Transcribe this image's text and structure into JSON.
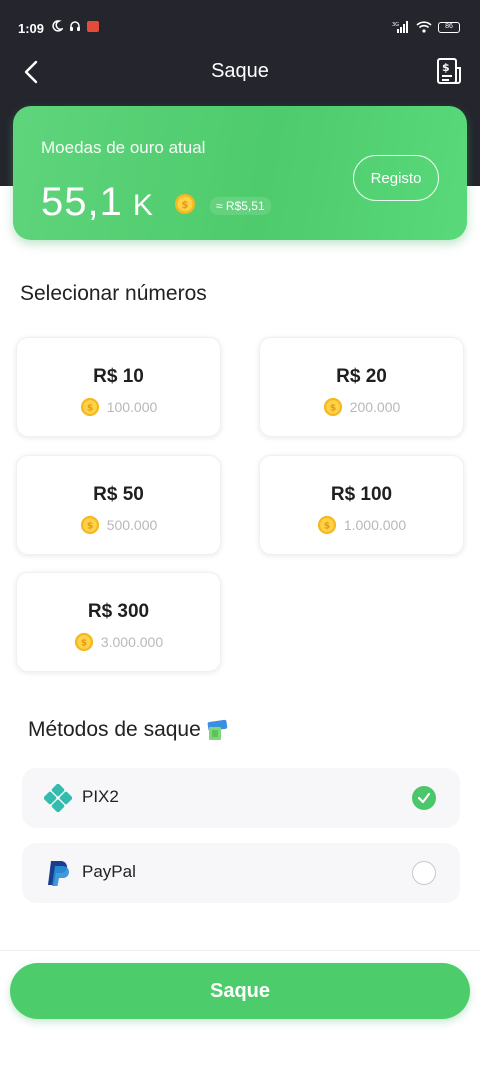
{
  "status_bar": {
    "time": "1:09",
    "battery": "86"
  },
  "nav": {
    "title": "Saque"
  },
  "balance": {
    "label": "Moedas de ouro atual",
    "value": "55,1",
    "unit": "K",
    "approx": "≈ R$5,51",
    "record_button": "Registo"
  },
  "amounts": {
    "title": "Selecionar números",
    "options": [
      {
        "value": "R$ 10",
        "coins": "100.000"
      },
      {
        "value": "R$ 20",
        "coins": "200.000"
      },
      {
        "value": "R$ 50",
        "coins": "500.000"
      },
      {
        "value": "R$ 100",
        "coins": "1.000.000"
      },
      {
        "value": "R$ 300",
        "coins": "3.000.000"
      }
    ]
  },
  "methods": {
    "title": "Métodos de saque",
    "items": [
      {
        "label": "PIX2",
        "selected": true
      },
      {
        "label": "PayPal",
        "selected": false
      }
    ]
  },
  "submit": {
    "label": "Saque"
  },
  "colors": {
    "accent": "#4dcc6b",
    "header_bg": "#24252d"
  }
}
